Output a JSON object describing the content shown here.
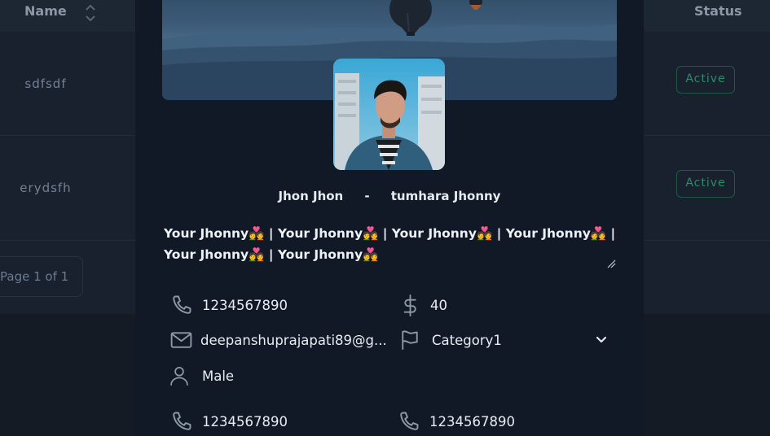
{
  "table": {
    "headers": {
      "name": "Name",
      "status": "Status"
    },
    "rows": [
      {
        "name": "sdfsdf",
        "status": "Active"
      },
      {
        "name": "erydsfh",
        "status": "Active"
      }
    ],
    "pagination": "Page 1 of 1"
  },
  "profile": {
    "name": "Jhon Jhon",
    "separator": "-",
    "nickname": "tumhara Jhonny",
    "bio": "Your Jhonny💑 | Your Jhonny💑 | Your Jhonny💑 | Your Jhonny💑 | Your Jhonny💑 | Your Jhonny💑",
    "phone": "1234567890",
    "amount": "40",
    "email": "deepanshuprajapati89@g...",
    "category": "Category1",
    "gender": "Male",
    "phone_2": "1234567890",
    "phone_3": "1234567890"
  },
  "colors": {
    "accent_active": "#2a8e66",
    "modal_bg": "#111926",
    "page_bg": "#18212d"
  },
  "icons": [
    "sort-icon",
    "phone-icon",
    "dollar-icon",
    "mail-icon",
    "flag-icon",
    "user-icon",
    "chevron-down-icon",
    "resize-grip-icon"
  ]
}
